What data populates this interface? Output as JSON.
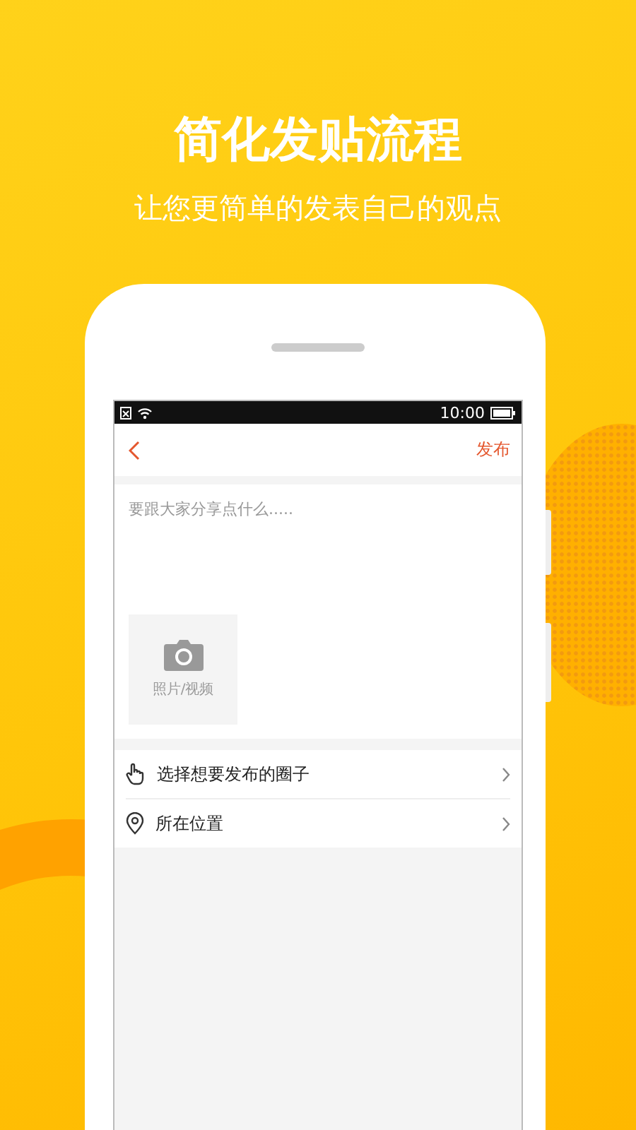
{
  "headline": "简化发贴流程",
  "subheadline": "让您更简单的发表自己的观点",
  "status_bar": {
    "time": "10:00"
  },
  "nav": {
    "publish": "发布"
  },
  "post": {
    "placeholder": "要跟大家分享点什么.....",
    "media_label": "照片/视频"
  },
  "options": [
    {
      "kind": "circle",
      "label": "选择想要发布的圈子"
    },
    {
      "kind": "location",
      "label": "所在位置"
    }
  ]
}
